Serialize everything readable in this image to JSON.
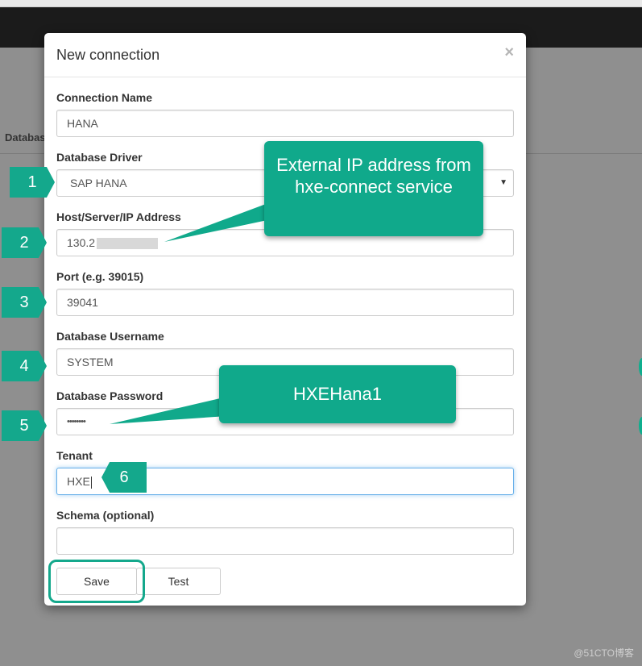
{
  "background": {
    "left_label": "Databas"
  },
  "modal": {
    "title": "New connection",
    "close_glyph": "×",
    "fields": {
      "connection_name": {
        "label": "Connection Name",
        "value": "HANA"
      },
      "database_driver": {
        "label": "Database Driver",
        "value": "SAP HANA"
      },
      "host": {
        "label": "Host/Server/IP Address",
        "value": "130.2"
      },
      "port": {
        "label": "Port (e.g. 39015)",
        "value": "39041"
      },
      "username": {
        "label": "Database Username",
        "value": "SYSTEM"
      },
      "password": {
        "label": "Database Password",
        "value": "••••••••"
      },
      "tenant": {
        "label": "Tenant",
        "value": "HXE"
      },
      "schema": {
        "label": "Schema (optional)",
        "value": ""
      }
    },
    "buttons": {
      "save": "Save",
      "test": "Test"
    }
  },
  "annotations": {
    "badges": [
      "1",
      "2",
      "3",
      "4",
      "5",
      "6"
    ],
    "callout_ip": "External IP address from hxe-connect service",
    "callout_password": "HXEHana1"
  },
  "watermark": "@51CTO博客",
  "colors": {
    "accent": "#14a88c",
    "focus": "#66afe9"
  }
}
